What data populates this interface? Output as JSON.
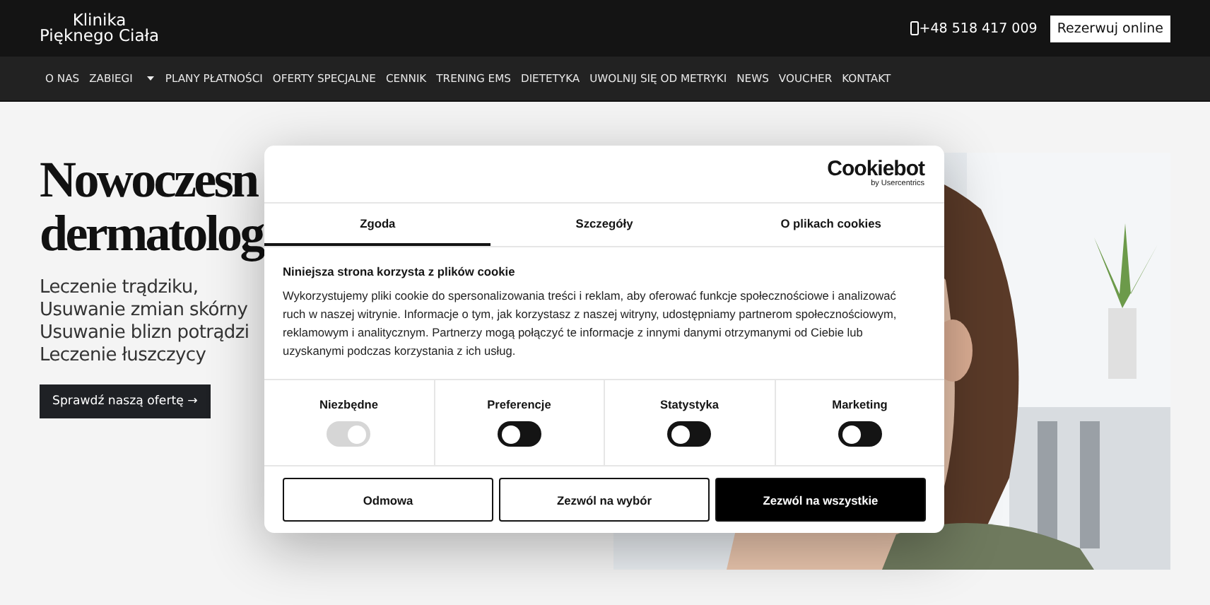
{
  "header": {
    "logo": [
      "Klinika",
      "Pięknego Ciała"
    ],
    "phone": "+48 518 417 009",
    "cta": "Rezerwuj online"
  },
  "nav": [
    {
      "label": "O NAS",
      "dropdown": false
    },
    {
      "label": "ZABIEGI",
      "dropdown": true
    },
    {
      "label": "PLANY PŁATNOŚCI",
      "dropdown": false
    },
    {
      "label": "OFERTY SPECJALNE",
      "dropdown": false
    },
    {
      "label": "CENNIK",
      "dropdown": false
    },
    {
      "label": "TRENING EMS",
      "dropdown": false
    },
    {
      "label": "DIETETYKA",
      "dropdown": false
    },
    {
      "label": "UWOLNIJ SIĘ OD METRYKI",
      "dropdown": false
    },
    {
      "label": "NEWS",
      "dropdown": false
    },
    {
      "label": "VOUCHER",
      "dropdown": false
    },
    {
      "label": "KONTAKT",
      "dropdown": false
    }
  ],
  "hero": {
    "heading": [
      "Nowoczesn",
      "dermatolog"
    ],
    "lines": [
      "Leczenie trądziku,",
      "Usuwanie zmian skórny",
      "Usuwanie blizn potrądzi",
      "Leczenie łuszczycy"
    ],
    "button": "Sprawdź naszą ofertę →",
    "image": {
      "kind": "picture"
    }
  },
  "cookie_dialog": {
    "logo": "Cookiebot",
    "logo_sub": "by Usercentrics",
    "tabs": [
      {
        "label": "Zgoda",
        "selected": true
      },
      {
        "label": "Szczegóły",
        "selected": false
      },
      {
        "label": "O plikach cookies",
        "selected": false
      }
    ],
    "title": "Niniejsza strona korzysta z plików cookie",
    "text": "Wykorzystujemy pliki cookie do spersonalizowania treści i reklam, aby oferować funkcje społecznościowe i analizować ruch w naszej witrynie. Informacje o tym, jak korzystasz z naszej witryny, udostępniamy partnerom społecznościowym, reklamowym i analitycznym. Partnerzy mogą połączyć te informacje z innymi danymi otrzymanymi od Ciebie lub uzyskanymi podczas korzystania z ich usług.",
    "toggles": [
      {
        "label": "Niezbędne",
        "checked": true,
        "disabled": true
      },
      {
        "label": "Preferencje",
        "checked": false,
        "disabled": false
      },
      {
        "label": "Statystyka",
        "checked": false,
        "disabled": false
      },
      {
        "label": "Marketing",
        "checked": false,
        "disabled": false
      }
    ],
    "buttons": [
      {
        "label": "Odmowa",
        "kind": "outline"
      },
      {
        "label": "Zezwól na wybór",
        "kind": "outline"
      },
      {
        "label": "Zezwól na wszystkie",
        "kind": "filled"
      }
    ]
  }
}
